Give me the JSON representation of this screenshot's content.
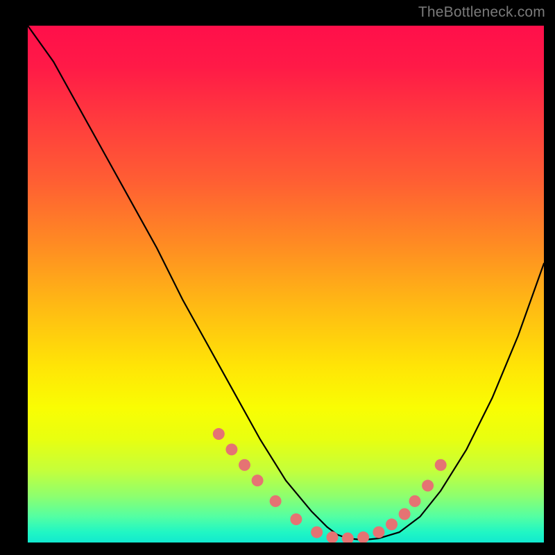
{
  "watermark": "TheBottleneck.com",
  "chart_data": {
    "type": "line",
    "title": "",
    "xlabel": "",
    "ylabel": "",
    "xlim": [
      0,
      100
    ],
    "ylim": [
      0,
      100
    ],
    "series": [
      {
        "name": "bottleneck-curve",
        "x": [
          0,
          5,
          10,
          15,
          20,
          25,
          30,
          35,
          40,
          45,
          50,
          55,
          58,
          60,
          62,
          65,
          68,
          72,
          76,
          80,
          85,
          90,
          95,
          100
        ],
        "values": [
          100,
          93,
          84,
          75,
          66,
          57,
          47,
          38,
          29,
          20,
          12,
          6,
          3,
          1.5,
          0.8,
          0.5,
          0.8,
          2,
          5,
          10,
          18,
          28,
          40,
          54
        ]
      }
    ],
    "markers": {
      "name": "highlight-dots",
      "color": "#e57373",
      "x": [
        37,
        39.5,
        42,
        44.5,
        48,
        52,
        56,
        59,
        62,
        65,
        68,
        70.5,
        73,
        75,
        77.5,
        80
      ],
      "values": [
        21,
        18,
        15,
        12,
        8,
        4.5,
        2,
        1,
        0.8,
        1,
        2,
        3.5,
        5.5,
        8,
        11,
        15
      ]
    }
  }
}
